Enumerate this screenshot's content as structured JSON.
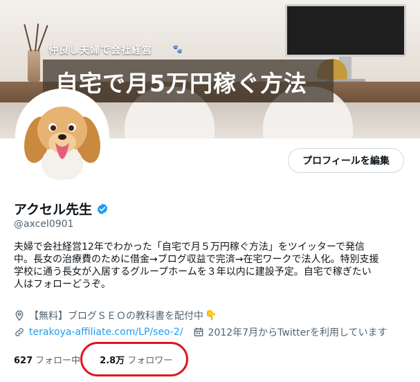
{
  "banner": {
    "tagline": "仲良し夫婦で会社経営",
    "headline": "自宅で月5万円稼ぐ方法",
    "paw_icon": "paw-icon"
  },
  "profile": {
    "edit_button": "プロフィールを編集",
    "name": "アクセル先生",
    "handle": "@axcel0901",
    "verified_icon": "verified-badge-icon",
    "verified_color": "#1d9bf0"
  },
  "bio": {
    "lines": [
      "夫婦で会社経営12年でわかった「自宅で月５万円稼ぐ方法」をツイッターで発信",
      "中。長女の治療費のために借金→ブログ収益で完済→在宅ワークで法人化。特別支援",
      "学校に通う長女が入居するグループホームを３年以内に建設予定。自宅で稼ぎたい",
      "人はフォローどうぞ。"
    ]
  },
  "meta": {
    "location": "【無料】ブログＳＥＯの教科書を配付中",
    "location_icon": "location-pin-icon",
    "finger_icon": "pointing-down-icon",
    "link_text": "terakoya-affiliate.com/LP/seo-2/",
    "link_icon": "link-icon",
    "joined": "2012年7月からTwitterを利用しています",
    "calendar_icon": "calendar-icon"
  },
  "stats": {
    "following_count": "627",
    "following_label": "フォロー中",
    "followers_count": "2.8万",
    "followers_label": "フォロワー"
  },
  "colors": {
    "accent": "#1d9bf0",
    "text": "#0f1419",
    "muted": "#536471",
    "highlight": "#e0141e"
  }
}
